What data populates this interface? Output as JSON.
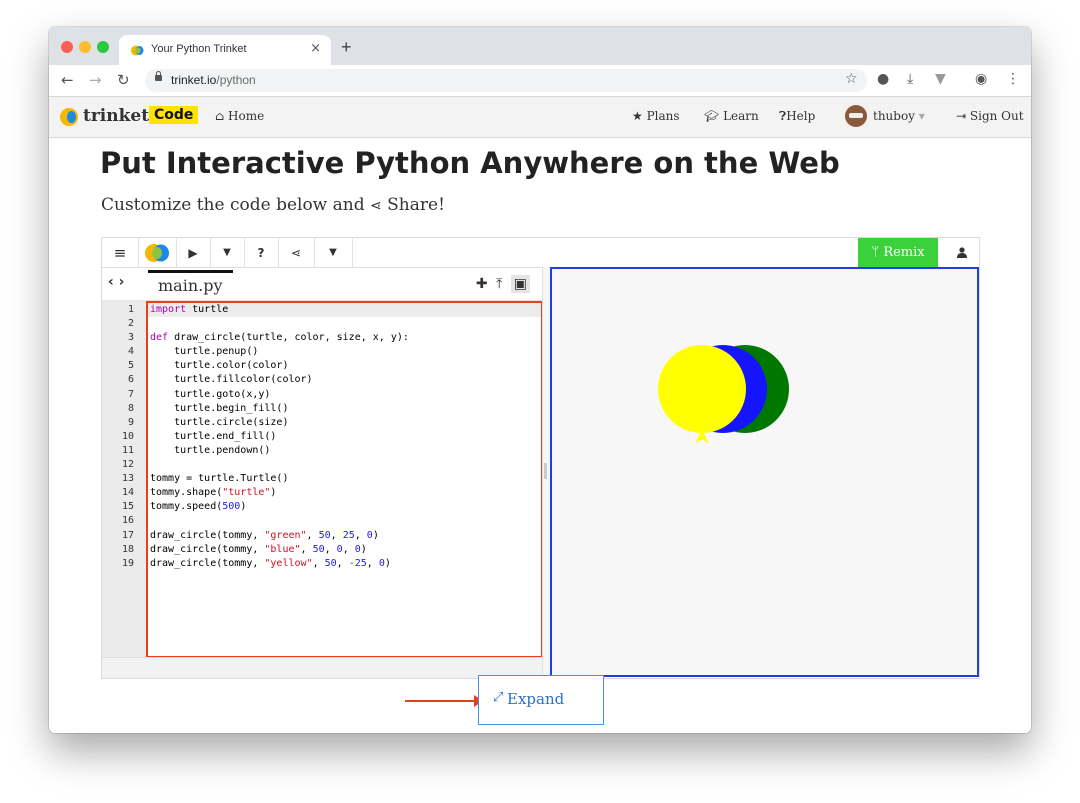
{
  "browser": {
    "tab_title": "Your Python Trinket",
    "tab_close": "×",
    "new_tab": "+",
    "url_host": "trinket.io",
    "url_path": "/python",
    "traffic_colors": [
      "#fe5f57",
      "#febc2e",
      "#28c840"
    ]
  },
  "site_nav": {
    "logo": "trinket",
    "badge": "Code",
    "home": "Home",
    "plans": "Plans",
    "learn": "Learn",
    "help": "Help",
    "user": "thuboy",
    "signout": "Sign Out"
  },
  "hero": {
    "title": "Put Interactive Python Anywhere on the Web",
    "subtitle_before": "Customize the code below and ",
    "subtitle_share": "Share!"
  },
  "embed": {
    "remix_label": "Remix",
    "file_name": "main.py",
    "line_numbers": [
      "1",
      "2",
      "3",
      "4",
      "5",
      "6",
      "7",
      "8",
      "9",
      "10",
      "11",
      "12",
      "13",
      "14",
      "15",
      "16",
      "17",
      "18",
      "19"
    ],
    "code_lines": [
      "import turtle",
      "",
      "def draw_circle(turtle, color, size, x, y):",
      "    turtle.penup()",
      "    turtle.color(color)",
      "    turtle.fillcolor(color)",
      "    turtle.goto(x,y)",
      "    turtle.begin_fill()",
      "    turtle.circle(size)",
      "    turtle.end_fill()",
      "    turtle.pendown()",
      "",
      "tommy = turtle.Turtle()",
      "tommy.shape(\"turtle\")",
      "tommy.speed(500)",
      "",
      "draw_circle(tommy, \"green\", 50, 25, 0)",
      "draw_circle(tommy, \"blue\", 50, 0, 0)",
      "draw_circle(tommy, \"yellow\", 50, -25, 0)"
    ],
    "circle_colors": [
      "green",
      "blue",
      "yellow"
    ],
    "expand_label": "Expand"
  },
  "colors": {
    "accent_red": "#e8401c",
    "output_border": "#1f3fe0",
    "remix_green": "#3ad13a",
    "badge_yellow": "#ffe200"
  }
}
